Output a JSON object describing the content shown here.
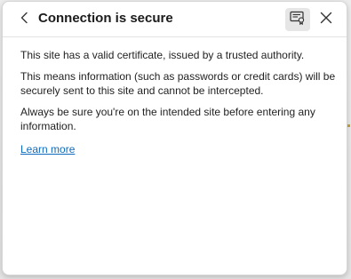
{
  "header": {
    "title": "Connection is secure",
    "back_icon": "chevron-left-icon",
    "certificate_icon": "certificate-icon",
    "close_icon": "close-icon"
  },
  "body": {
    "paragraph_1": "This site has a valid certificate, issued by a trusted authority.",
    "paragraph_2": "This means information (such as passwords or credit cards) will be securely sent to this site and cannot be intercepted.",
    "paragraph_3": "Always be sure you're on the intended site before entering any information.",
    "learn_more": "Learn more"
  },
  "colors": {
    "link": "#0f6cbd",
    "text": "#1f1f1f",
    "cert_button_bg": "#e6e6e6"
  }
}
